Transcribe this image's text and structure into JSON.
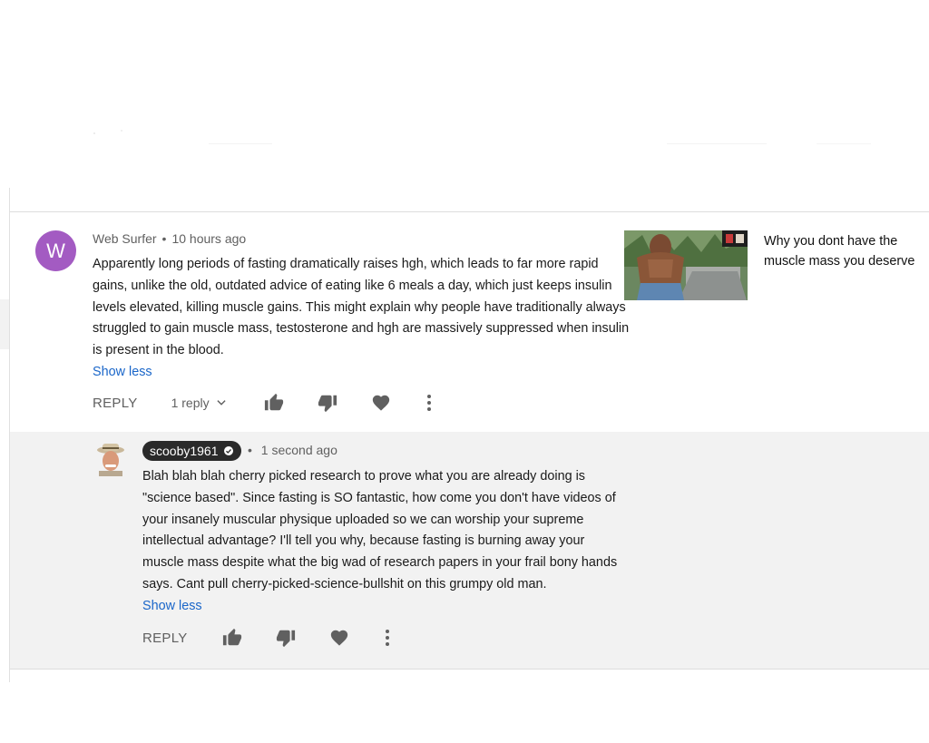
{
  "main_comment": {
    "avatar_letter": "W",
    "author": "Web Surfer",
    "separator": "•",
    "time": "10 hours ago",
    "text": "Apparently long periods of fasting dramatically raises hgh, which leads to far more rapid gains, unlike the old, outdated advice of eating like 6 meals a day, which just keeps insulin levels elevated, killing muscle gains. This might explain why people have traditionally always struggled to gain muscle mass, testosterone and hgh are massively suppressed when insulin is present in the blood.",
    "show_less": "Show less",
    "reply_label": "REPLY",
    "replies_label": "1 reply",
    "avatar_color": "#a35bc2"
  },
  "video_card": {
    "title": "Why you dont have the muscle mass you deserve"
  },
  "reply_comment": {
    "author": "scooby1961",
    "separator": "•",
    "time": "1 second ago",
    "text": "Blah blah blah cherry picked research to prove what you are already doing is \"science based\".  Since fasting is SO fantastic, how come you don't have videos of your insanely muscular physique uploaded so we can worship your supreme intellectual advantage?  I'll tell you why, because fasting is burning away your muscle mass despite what the big wad of research papers in your frail bony hands says. Cant pull cherry-picked-science-bullshit on this grumpy old man.",
    "show_less": "Show less",
    "reply_label": "REPLY"
  },
  "colors": {
    "link": "#1a66c9",
    "meta_text": "#606060",
    "reply_bg": "#f2f2f2",
    "chip_bg": "#2a2a2a"
  },
  "icons": [
    "like-icon",
    "dislike-icon",
    "heart-icon",
    "more-vert-icon",
    "chevron-down-icon",
    "verified-check-icon"
  ]
}
